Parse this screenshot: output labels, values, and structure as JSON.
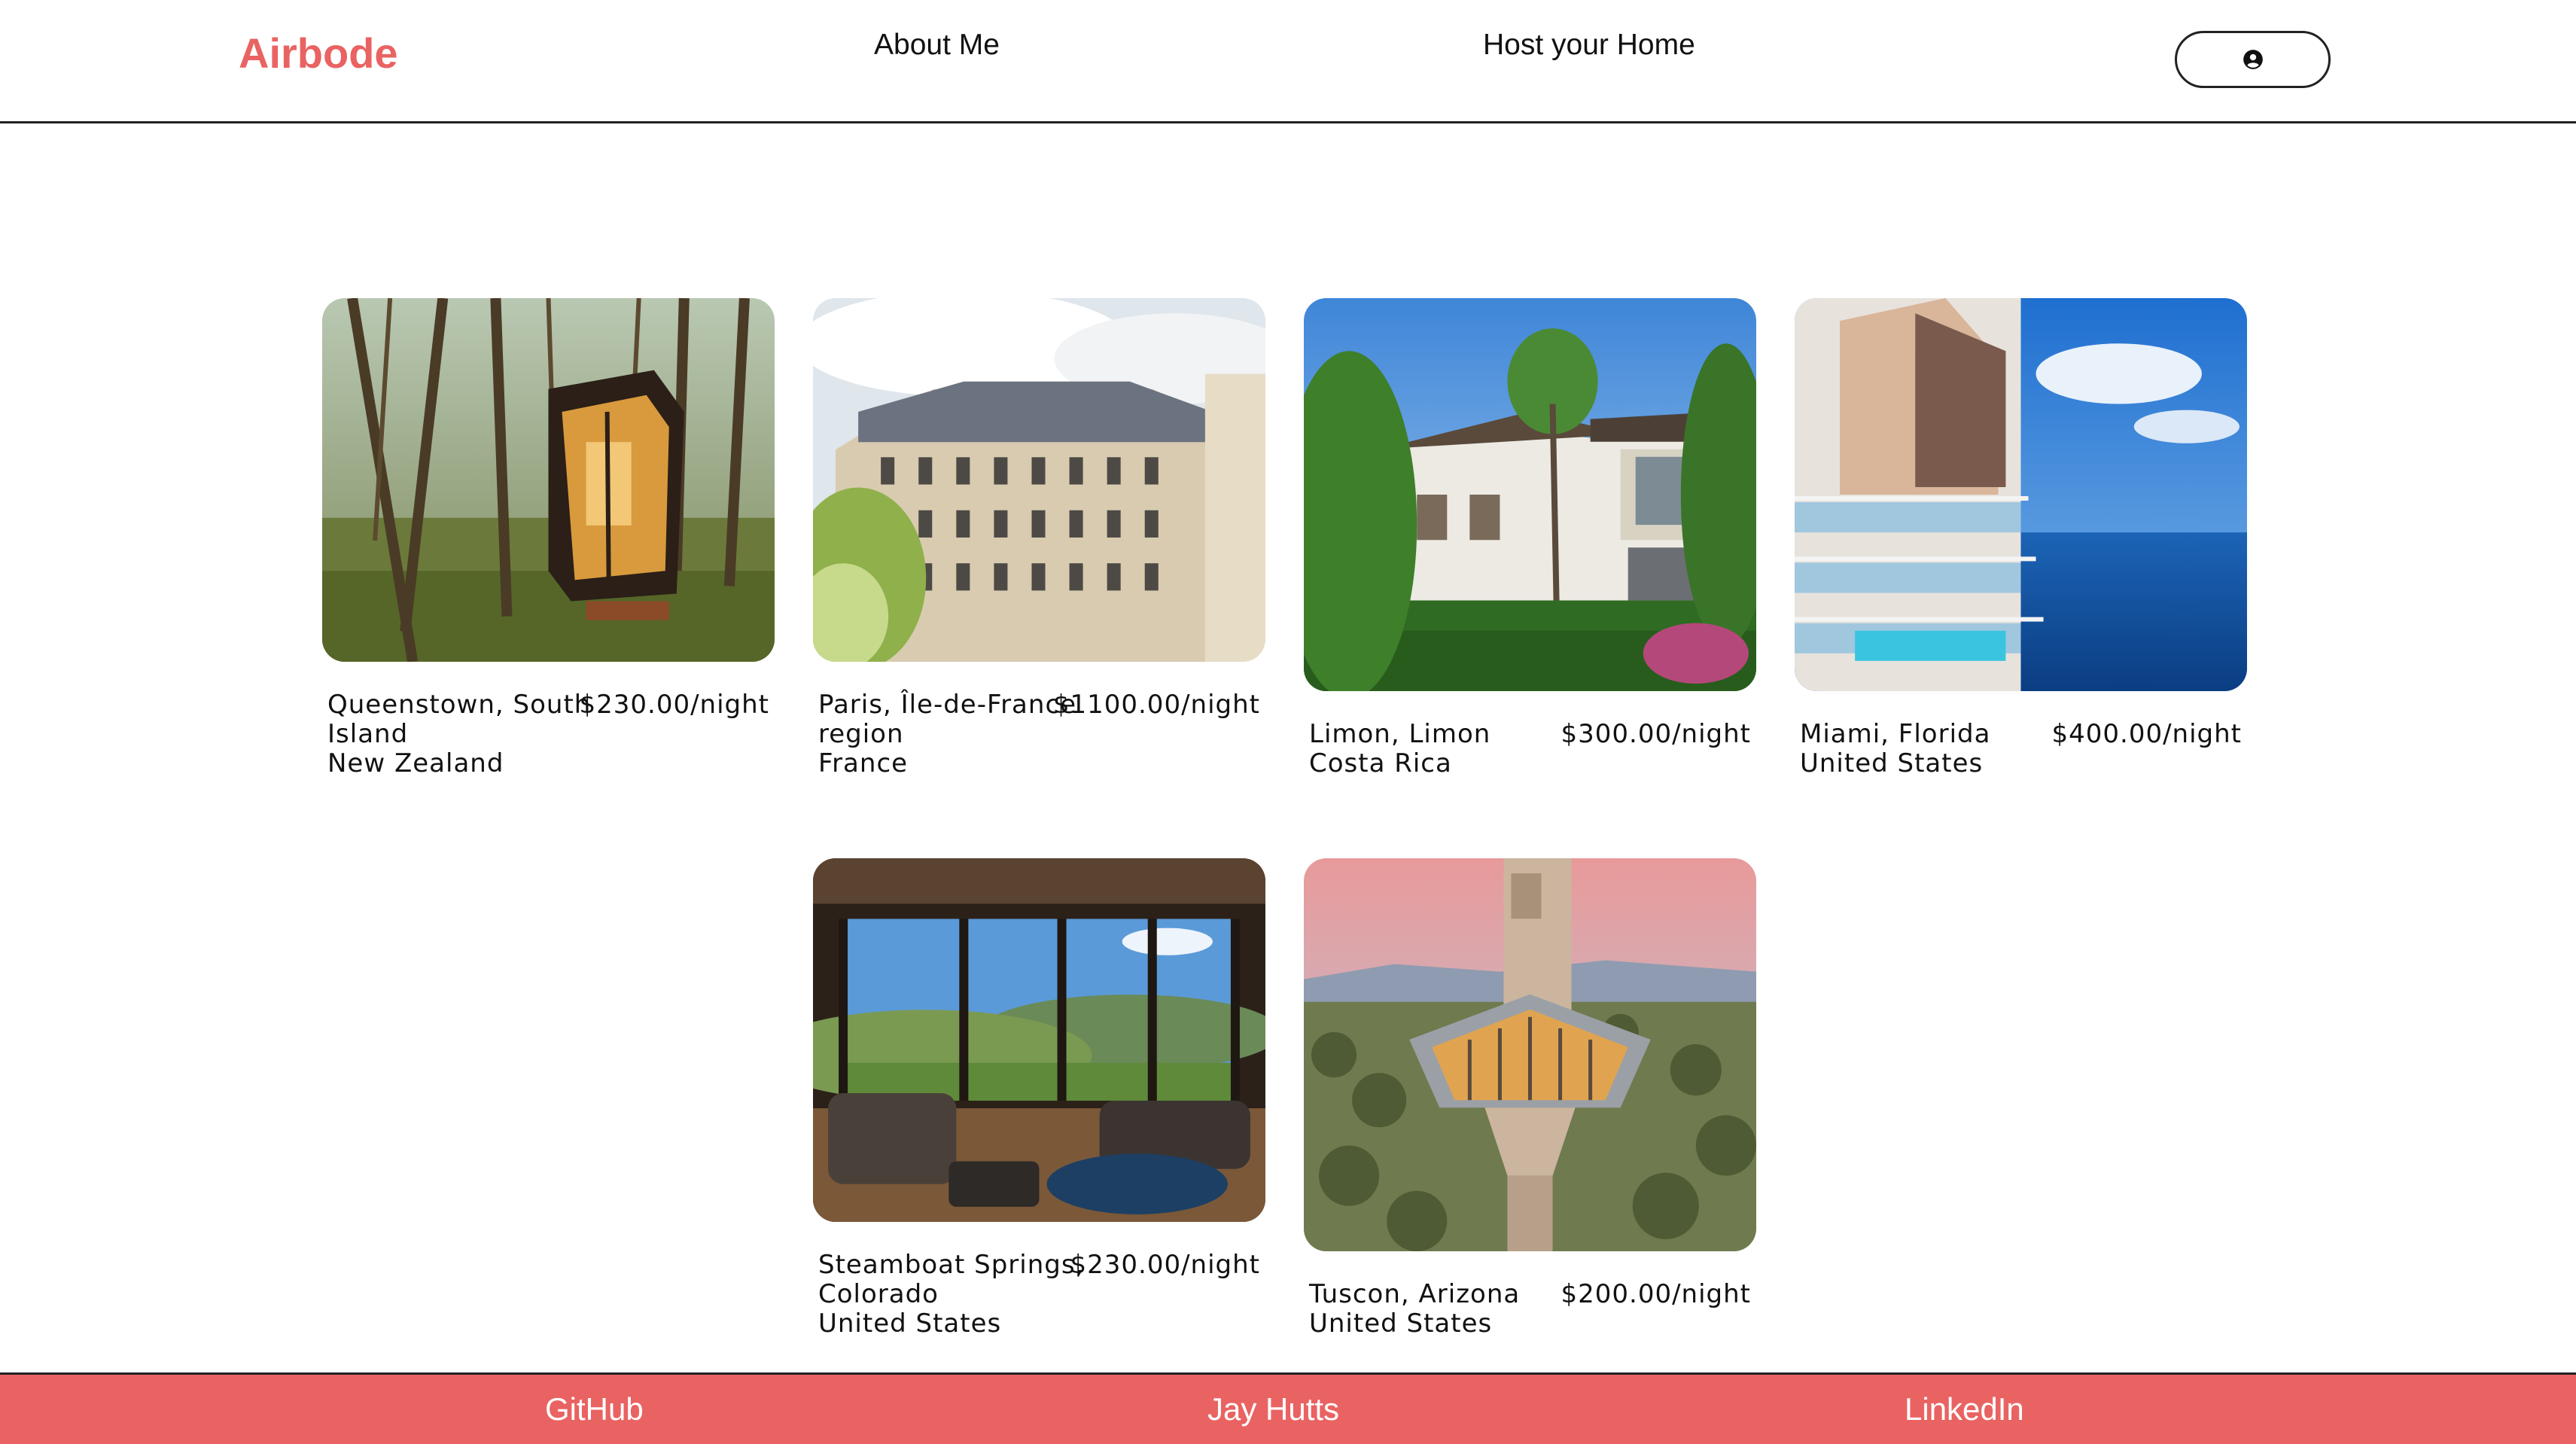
{
  "header": {
    "logo": "Airbode",
    "nav": {
      "about": "About Me",
      "host": "Host your Home"
    },
    "profile_icon": "user-circle-icon"
  },
  "listings": [
    {
      "location_line1": "Queenstown, South Island",
      "location_line2": "New Zealand",
      "price": "$230.00/night",
      "image": "forest-cabin-photo"
    },
    {
      "location_line1": "Paris, Île-de-France region",
      "location_line2": "France",
      "price": "$1100.00/night",
      "image": "paris-apartments-photo"
    },
    {
      "location_line1": "Limon, Limon",
      "location_line2": "Costa Rica",
      "price": "$300.00/night",
      "image": "tropical-villa-photo"
    },
    {
      "location_line1": "Miami, Florida",
      "location_line2": "United States",
      "price": "$400.00/night",
      "image": "oceanfront-condo-photo"
    },
    {
      "location_line1": "Steamboat Springs, Colorado",
      "location_line2": "United States",
      "price": "$230.00/night",
      "image": "mountain-living-room-photo"
    },
    {
      "location_line1": "Tuscon, Arizona",
      "location_line2": "United States",
      "price": "$200.00/night",
      "image": "desert-tower-house-photo"
    }
  ],
  "footer": {
    "github": "GitHub",
    "name": "Jay Hutts",
    "linkedin": "LinkedIn"
  },
  "colors": {
    "brand": "#e96362",
    "text": "#111111",
    "border": "#222222"
  }
}
